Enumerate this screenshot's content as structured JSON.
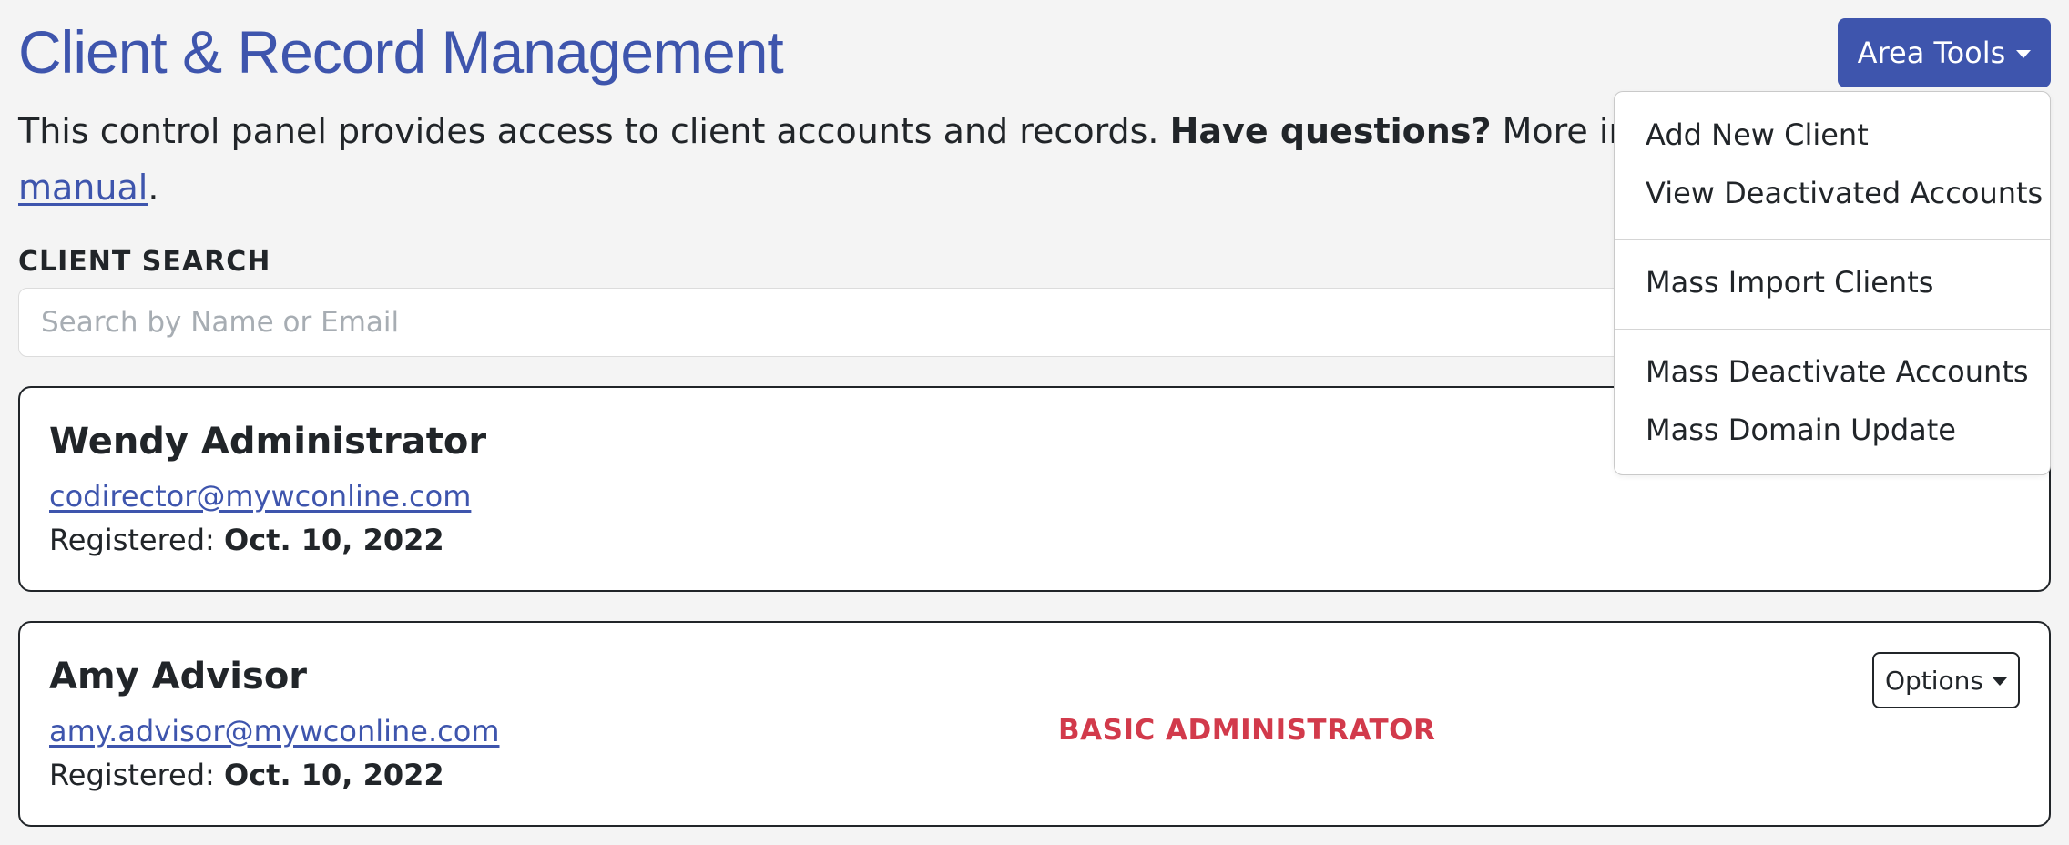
{
  "header": {
    "title": "Client & Record Management",
    "area_tools_label": "Area Tools"
  },
  "intro": {
    "text_before": "This control panel provides access to client accounts and records. ",
    "bold_text": "Have questions?",
    "text_after": " More info",
    "manual_link": "manual",
    "period": "."
  },
  "search": {
    "label": "CLIENT SEARCH",
    "placeholder": "Search by Name or Email",
    "value": ""
  },
  "area_tools_menu": {
    "items": [
      "Add New Client",
      "View Deactivated Accounts",
      "Mass Import Clients",
      "Mass Deactivate Accounts",
      "Mass Domain Update"
    ]
  },
  "clients": [
    {
      "name": "Wendy Administrator",
      "email": "codirector@mywconline.com",
      "registered_label": "Registered: ",
      "registered_date": "Oct. 10, 2022"
    },
    {
      "name": "Amy Advisor",
      "email": "amy.advisor@mywconline.com",
      "registered_label": "Registered: ",
      "registered_date": "Oct. 10, 2022",
      "role": "BASIC ADMINISTRATOR",
      "options_label": "Options"
    }
  ],
  "colors": {
    "primary": "#3e55ad",
    "role_badge": "#d23a4b",
    "background": "#f4f4f4"
  },
  "icons": {
    "area_tools_caret": "caret-down-icon",
    "options_caret": "caret-down-icon"
  }
}
